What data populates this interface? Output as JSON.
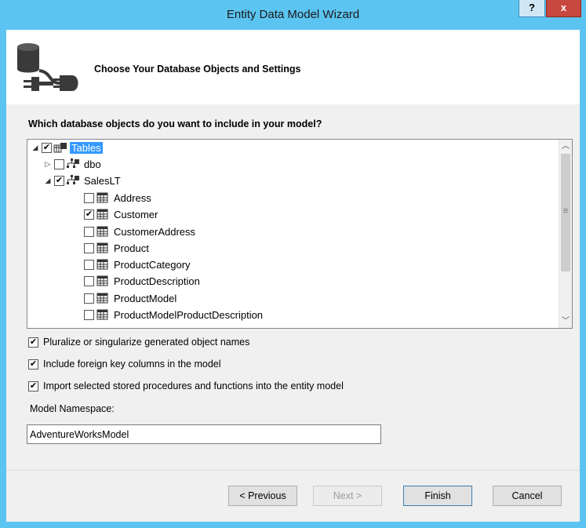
{
  "window": {
    "title": "Entity Data Model Wizard",
    "help_label": "?",
    "close_label": "x"
  },
  "header": {
    "title": "Choose Your Database Objects and Settings",
    "icon": "database-plug-icon"
  },
  "tree": {
    "question": "Which database objects do you want to include in your model?",
    "root": {
      "label": "Tables",
      "checked": true,
      "expanded": true,
      "selected": true
    },
    "schemas": [
      {
        "label": "dbo",
        "checked": false,
        "expanded": false
      },
      {
        "label": "SalesLT",
        "checked": true,
        "expanded": true
      }
    ],
    "tables": [
      {
        "label": "Address",
        "checked": false
      },
      {
        "label": "Customer",
        "checked": true
      },
      {
        "label": "CustomerAddress",
        "checked": false
      },
      {
        "label": "Product",
        "checked": false
      },
      {
        "label": "ProductCategory",
        "checked": false
      },
      {
        "label": "ProductDescription",
        "checked": false
      },
      {
        "label": "ProductModel",
        "checked": false
      },
      {
        "label": "ProductModelProductDescription",
        "checked": false
      }
    ]
  },
  "options": {
    "pluralize": {
      "label": "Pluralize or singularize generated object names",
      "checked": true
    },
    "foreign_keys": {
      "label": "Include foreign key columns in the model",
      "checked": true
    },
    "import_procs": {
      "label": "Import selected stored procedures and functions into the entity model",
      "checked": true
    }
  },
  "namespace": {
    "label": "Model Namespace:",
    "value": "AdventureWorksModel"
  },
  "buttons": {
    "previous": "< Previous",
    "next": "Next >",
    "finish": "Finish",
    "cancel": "Cancel"
  },
  "colors": {
    "title_bar": "#5cc4f0",
    "selection": "#3399ff",
    "close_button": "#c7483e"
  }
}
